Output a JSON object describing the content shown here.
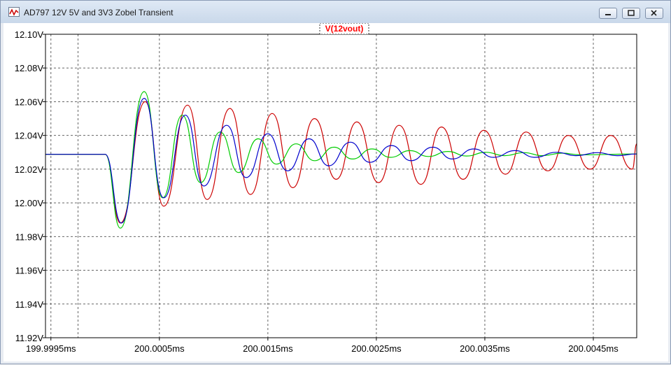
{
  "window": {
    "title": "AD797 12V 5V and 3V3 Zobel Transient",
    "icon": "waveform-icon",
    "controls": [
      "minimize-icon",
      "restore-icon",
      "close-icon"
    ]
  },
  "trace_label": "V(12vout)",
  "colors": {
    "background": "#ffffff",
    "grid": "#666666",
    "axis_text": "#000000",
    "trace_label": "#ff0000",
    "red_series": "#cc0000",
    "green_series": "#00cc00",
    "blue_series": "#0000cc"
  },
  "chart_data": {
    "type": "line",
    "title": "V(12vout)",
    "xlabel": "",
    "ylabel": "",
    "xlim_ms": [
      199.99945,
      200.0049
    ],
    "ylim": [
      11.92,
      12.1
    ],
    "grid": true,
    "x_tick_values_ms": [
      199.9995,
      200.0005,
      200.0015,
      200.0025,
      200.0035,
      200.0045
    ],
    "x_tick_labels": [
      "199.9995ms",
      "200.0005ms",
      "200.0015ms",
      "200.0025ms",
      "200.0035ms",
      "200.0045ms"
    ],
    "extra_vertical_grid_ms": [
      199.99975
    ],
    "y_tick_values": [
      12.1,
      12.08,
      12.06,
      12.04,
      12.02,
      12.0,
      11.98,
      11.96,
      11.94,
      11.92
    ],
    "y_tick_labels": [
      "12.10V",
      "12.08V",
      "12.06V",
      "12.04V",
      "12.02V",
      "12.00V",
      "11.98V",
      "11.96V",
      "11.94V",
      "11.92V"
    ],
    "series": [
      {
        "color": "#cc0000",
        "baseline": 12.0288,
        "step_start_ms": 200.0,
        "x_ms": [
          200.0,
          200.00014,
          200.00037,
          200.00054,
          200.00076,
          200.00094,
          200.00115,
          200.00134,
          200.00154,
          200.00173,
          200.00193,
          200.00213,
          200.00232,
          200.00252,
          200.00271,
          200.00291,
          200.0031,
          200.0033,
          200.00349,
          200.00369,
          200.00388,
          200.00408,
          200.00427,
          200.00447,
          200.00466,
          200.00486,
          200.0049
        ],
        "y": [
          12.0288,
          11.988,
          12.06,
          11.998,
          12.058,
          12.002,
          12.056,
          12.005,
          12.053,
          12.009,
          12.05,
          12.014,
          12.048,
          12.012,
          12.046,
          12.011,
          12.045,
          12.014,
          12.043,
          12.017,
          12.042,
          12.019,
          12.04,
          12.02,
          12.04,
          12.02,
          12.035
        ]
      },
      {
        "color": "#00cc00",
        "baseline": 12.0288,
        "step_start_ms": 200.0,
        "x_ms": [
          200.0,
          200.00014,
          200.00036,
          200.00053,
          200.00071,
          200.00088,
          200.00106,
          200.00123,
          200.00141,
          200.00158,
          200.00176,
          200.00193,
          200.00211,
          200.00228,
          200.00246,
          200.00263,
          200.00281,
          200.00298,
          200.00316,
          200.00333,
          200.00351,
          200.00368,
          200.00386,
          200.00403,
          200.00421,
          200.00438,
          200.0049
        ],
        "y": [
          12.0288,
          11.985,
          12.066,
          12.003,
          12.052,
          12.012,
          12.042,
          12.018,
          12.038,
          12.023,
          12.035,
          12.025,
          12.033,
          12.026,
          12.032,
          12.027,
          12.031,
          12.0275,
          12.0305,
          12.0278,
          12.03,
          12.028,
          12.0298,
          12.028,
          12.0295,
          12.0285,
          12.029
        ]
      },
      {
        "color": "#0000cc",
        "baseline": 12.0288,
        "step_start_ms": 200.0,
        "x_ms": [
          200.0,
          200.00015,
          200.00036,
          200.00054,
          200.00074,
          200.00091,
          200.00112,
          200.0013,
          200.0015,
          200.00168,
          200.00188,
          200.00206,
          200.00226,
          200.00244,
          200.00264,
          200.00282,
          200.00302,
          200.0032,
          200.0034,
          200.00358,
          200.00378,
          200.00396,
          200.00416,
          200.00434,
          200.00454,
          200.00472,
          200.0049
        ],
        "y": [
          12.0288,
          11.988,
          12.062,
          12.003,
          12.052,
          12.01,
          12.046,
          12.015,
          12.041,
          12.019,
          12.038,
          12.022,
          12.036,
          12.024,
          12.034,
          12.025,
          12.033,
          12.026,
          12.032,
          12.027,
          12.031,
          12.027,
          12.03,
          12.028,
          12.0298,
          12.028,
          12.029
        ]
      }
    ]
  }
}
